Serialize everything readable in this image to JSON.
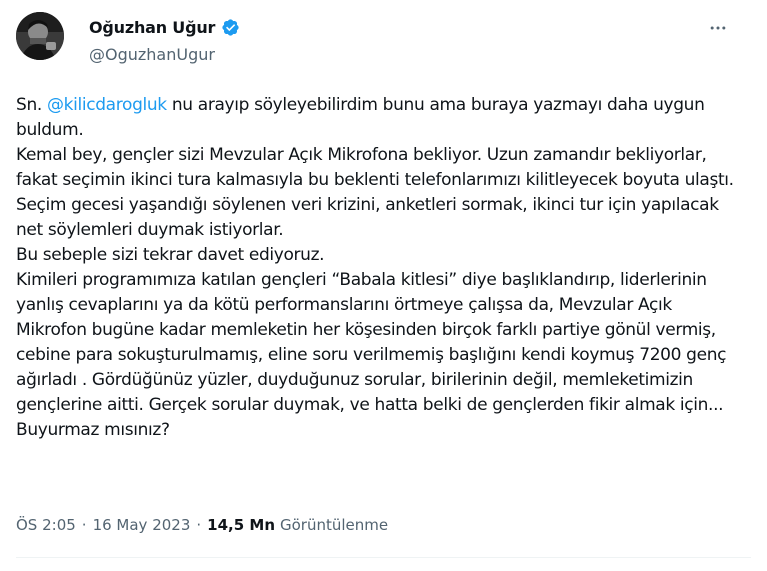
{
  "author": {
    "name": "Oğuzhan Uğur",
    "handle": "@OguzhanUgur",
    "verified_color": "#1d9bf0"
  },
  "tweet": {
    "prefix": "Sn. ",
    "mention": "@kilicdarogluk",
    "body": " nu arayıp söyleyebilirdim bunu ama buraya yazmayı daha uygun buldum.\nKemal bey, gençler sizi Mevzular Açık Mikrofona bekliyor. Uzun zamandır bekliyorlar, fakat seçimin ikinci tura kalmasıyla bu beklenti telefonlarımızı kilitleyecek boyuta ulaştı.\nSeçim gecesi yaşandığı söylenen veri krizini, anketleri sormak, ikinci tur için yapılacak net söylemleri duymak istiyorlar.\nBu sebeple sizi tekrar davet ediyoruz.\nKimileri programımıza katılan gençleri “Babala kitlesi” diye başlıklandırıp, liderlerinin yanlış cevaplarını ya da kötü performanslarını örtmeye çalışsa da, Mevzular Açık Mikrofon bugüne kadar memleketin her köşesinden birçok farklı partiye gönül vermiş, cebine para sokuşturulmamış, eline soru verilmemiş başlığını kendi koymuş 7200 genç ağırladı . Gördüğünüz yüzler, duyduğunuz sorular, birilerinin değil, memleketimizin gençlerine aitti. Gerçek sorular duymak, ve hatta belki de gençlerden fikir almak için... Buyurmaz mısınız?"
  },
  "meta": {
    "time": "ÖS 2:05",
    "separator": "·",
    "date": "16 May 2023",
    "views_count": "14,5 Mn",
    "views_label": "Görüntülenme"
  },
  "icons": {
    "verified": "verified-badge-icon",
    "more": "more-options-icon"
  }
}
